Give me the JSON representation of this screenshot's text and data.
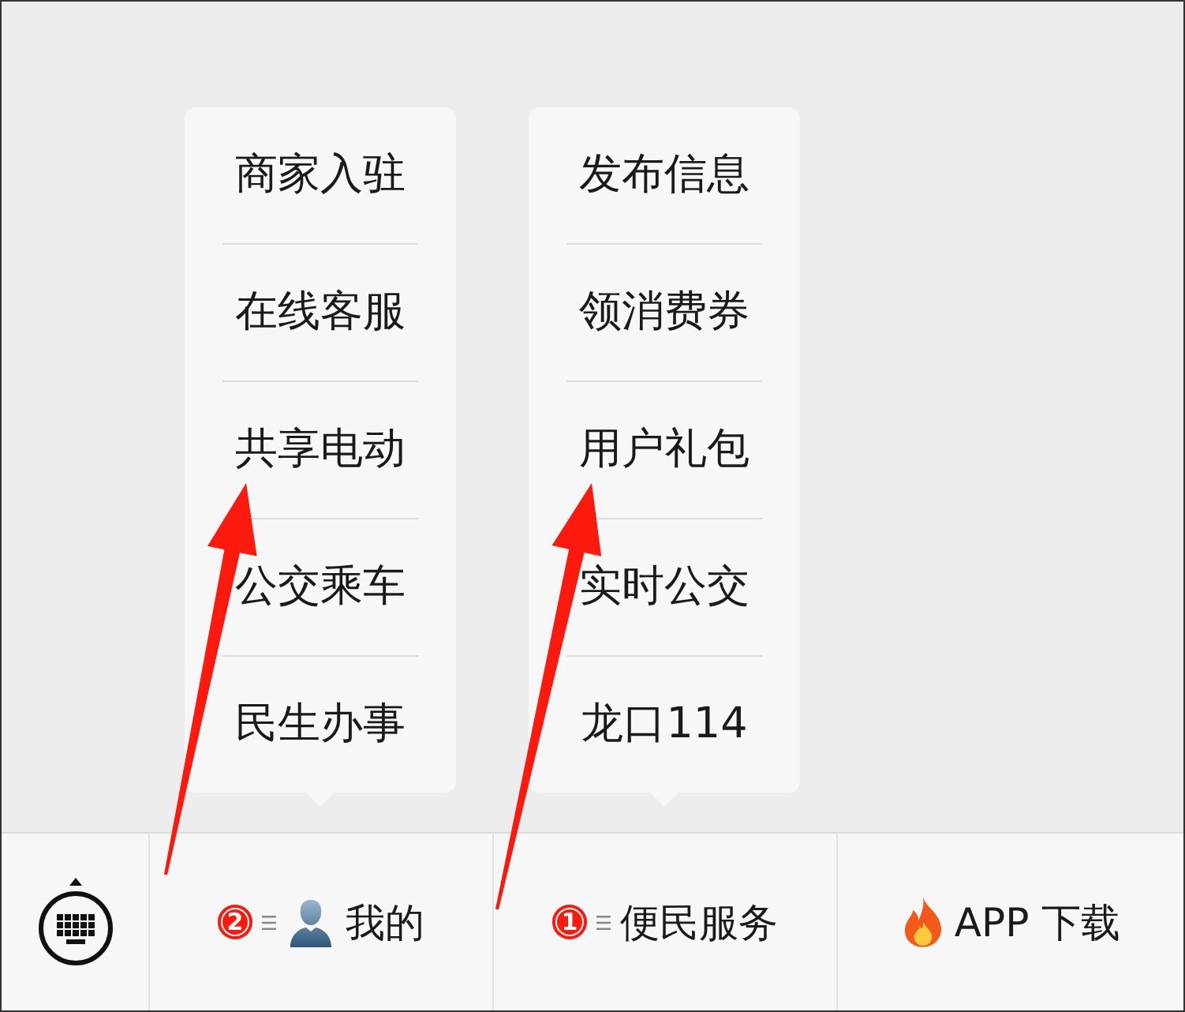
{
  "bottom_bar": {
    "items": [
      {
        "kind": "keyboard"
      },
      {
        "kind": "profile-menu",
        "label": "我的",
        "badge": "2",
        "submenu": [
          "商家入驻",
          "在线客服",
          "共享电动",
          "公交乘车",
          "民生办事"
        ]
      },
      {
        "kind": "menu",
        "label": "便民服务",
        "badge": "1",
        "submenu": [
          "发布信息",
          "领消费券",
          "用户礼包",
          "实时公交",
          "龙口114"
        ]
      },
      {
        "kind": "download",
        "label": "APP 下载"
      }
    ]
  }
}
